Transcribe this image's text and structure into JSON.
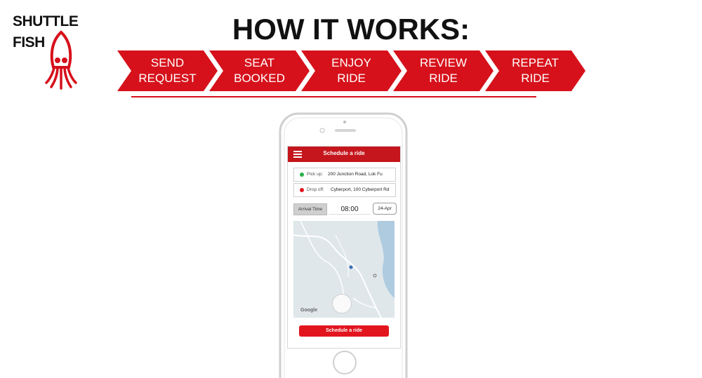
{
  "logo": {
    "line1": "SHUTTLE",
    "line2": "FISH",
    "icon": "squid-icon",
    "color": "#d6111b"
  },
  "title": "HOW IT WORKS:",
  "steps": [
    {
      "line1": "SEND",
      "line2": "REQUEST"
    },
    {
      "line1": "SEAT",
      "line2": "BOOKED"
    },
    {
      "line1": "ENJOY",
      "line2": "RIDE"
    },
    {
      "line1": "REVIEW",
      "line2": "RIDE"
    },
    {
      "line1": "REPEAT",
      "line2": "RIDE"
    }
  ],
  "accent_color": "#d6111b",
  "app": {
    "header_title": "Schedule a ride",
    "menu_icon": "hamburger-menu-icon",
    "pickup": {
      "label": "Pick up:",
      "value": "200 Junction Road, Lok Fu",
      "dot_color": "#2bb24c"
    },
    "dropoff": {
      "label": "Drop off:",
      "value": "Cyberport, 100 Cyberport Rd",
      "dot_color": "#e2151f"
    },
    "arrival_label": "Arrival Time",
    "time_value": "08:00",
    "date_value": "24-Apr",
    "map_logo": "Google",
    "schedule_button": "Schedule a ride"
  }
}
